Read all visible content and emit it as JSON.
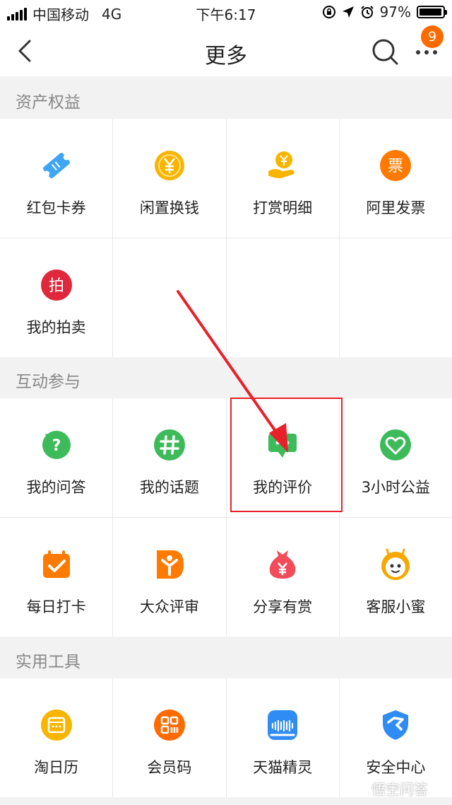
{
  "status_bar": {
    "carrier": "中国移动",
    "network": "4G",
    "time": "下午6:17",
    "battery": "97%",
    "battery_level": 0.97
  },
  "nav": {
    "title": "更多",
    "badge_count": "9"
  },
  "sections": [
    {
      "title": "资产权益",
      "items": [
        {
          "label": "红包卡券",
          "icon": "ticket-icon",
          "color": "#3fa6f5"
        },
        {
          "label": "闲置换钱",
          "icon": "yuan-coin-icon",
          "color": "#f7b500"
        },
        {
          "label": "打赏明细",
          "icon": "reward-hand-icon",
          "color": "#f7b500"
        },
        {
          "label": "阿里发票",
          "icon": "invoice-icon",
          "color": "#ff7a00"
        },
        {
          "label": "我的拍卖",
          "icon": "auction-icon",
          "color": "#e0283c"
        }
      ]
    },
    {
      "title": "互动参与",
      "items": [
        {
          "label": "我的问答",
          "icon": "question-bubble-icon",
          "color": "#3dbb5a"
        },
        {
          "label": "我的话题",
          "icon": "hashtag-icon",
          "color": "#3dbb5a"
        },
        {
          "label": "我的评价",
          "icon": "comment-icon",
          "color": "#3dbb5a"
        },
        {
          "label": "3小时公益",
          "icon": "charity-heart-icon",
          "color": "#3dbb5a"
        },
        {
          "label": "每日打卡",
          "icon": "calendar-check-icon",
          "color": "#ff7a00"
        },
        {
          "label": "大众评审",
          "icon": "review-badge-icon",
          "color": "#ff7a00"
        },
        {
          "label": "分享有赏",
          "icon": "money-bag-icon",
          "color": "#f24b5a"
        },
        {
          "label": "客服小蜜",
          "icon": "bee-mascot-icon",
          "color": "#f7a800"
        }
      ]
    },
    {
      "title": "实用工具",
      "items": [
        {
          "label": "淘日历",
          "icon": "calendar-icon",
          "color": "#f7b500"
        },
        {
          "label": "会员码",
          "icon": "qr-code-icon",
          "color": "#ff6a00"
        },
        {
          "label": "天猫精灵",
          "icon": "smart-speaker-icon",
          "color": "#2f8cf5"
        },
        {
          "label": "安全中心",
          "icon": "shield-icon",
          "color": "#2f8cf5"
        }
      ]
    }
  ],
  "watermark": "悟空问答"
}
